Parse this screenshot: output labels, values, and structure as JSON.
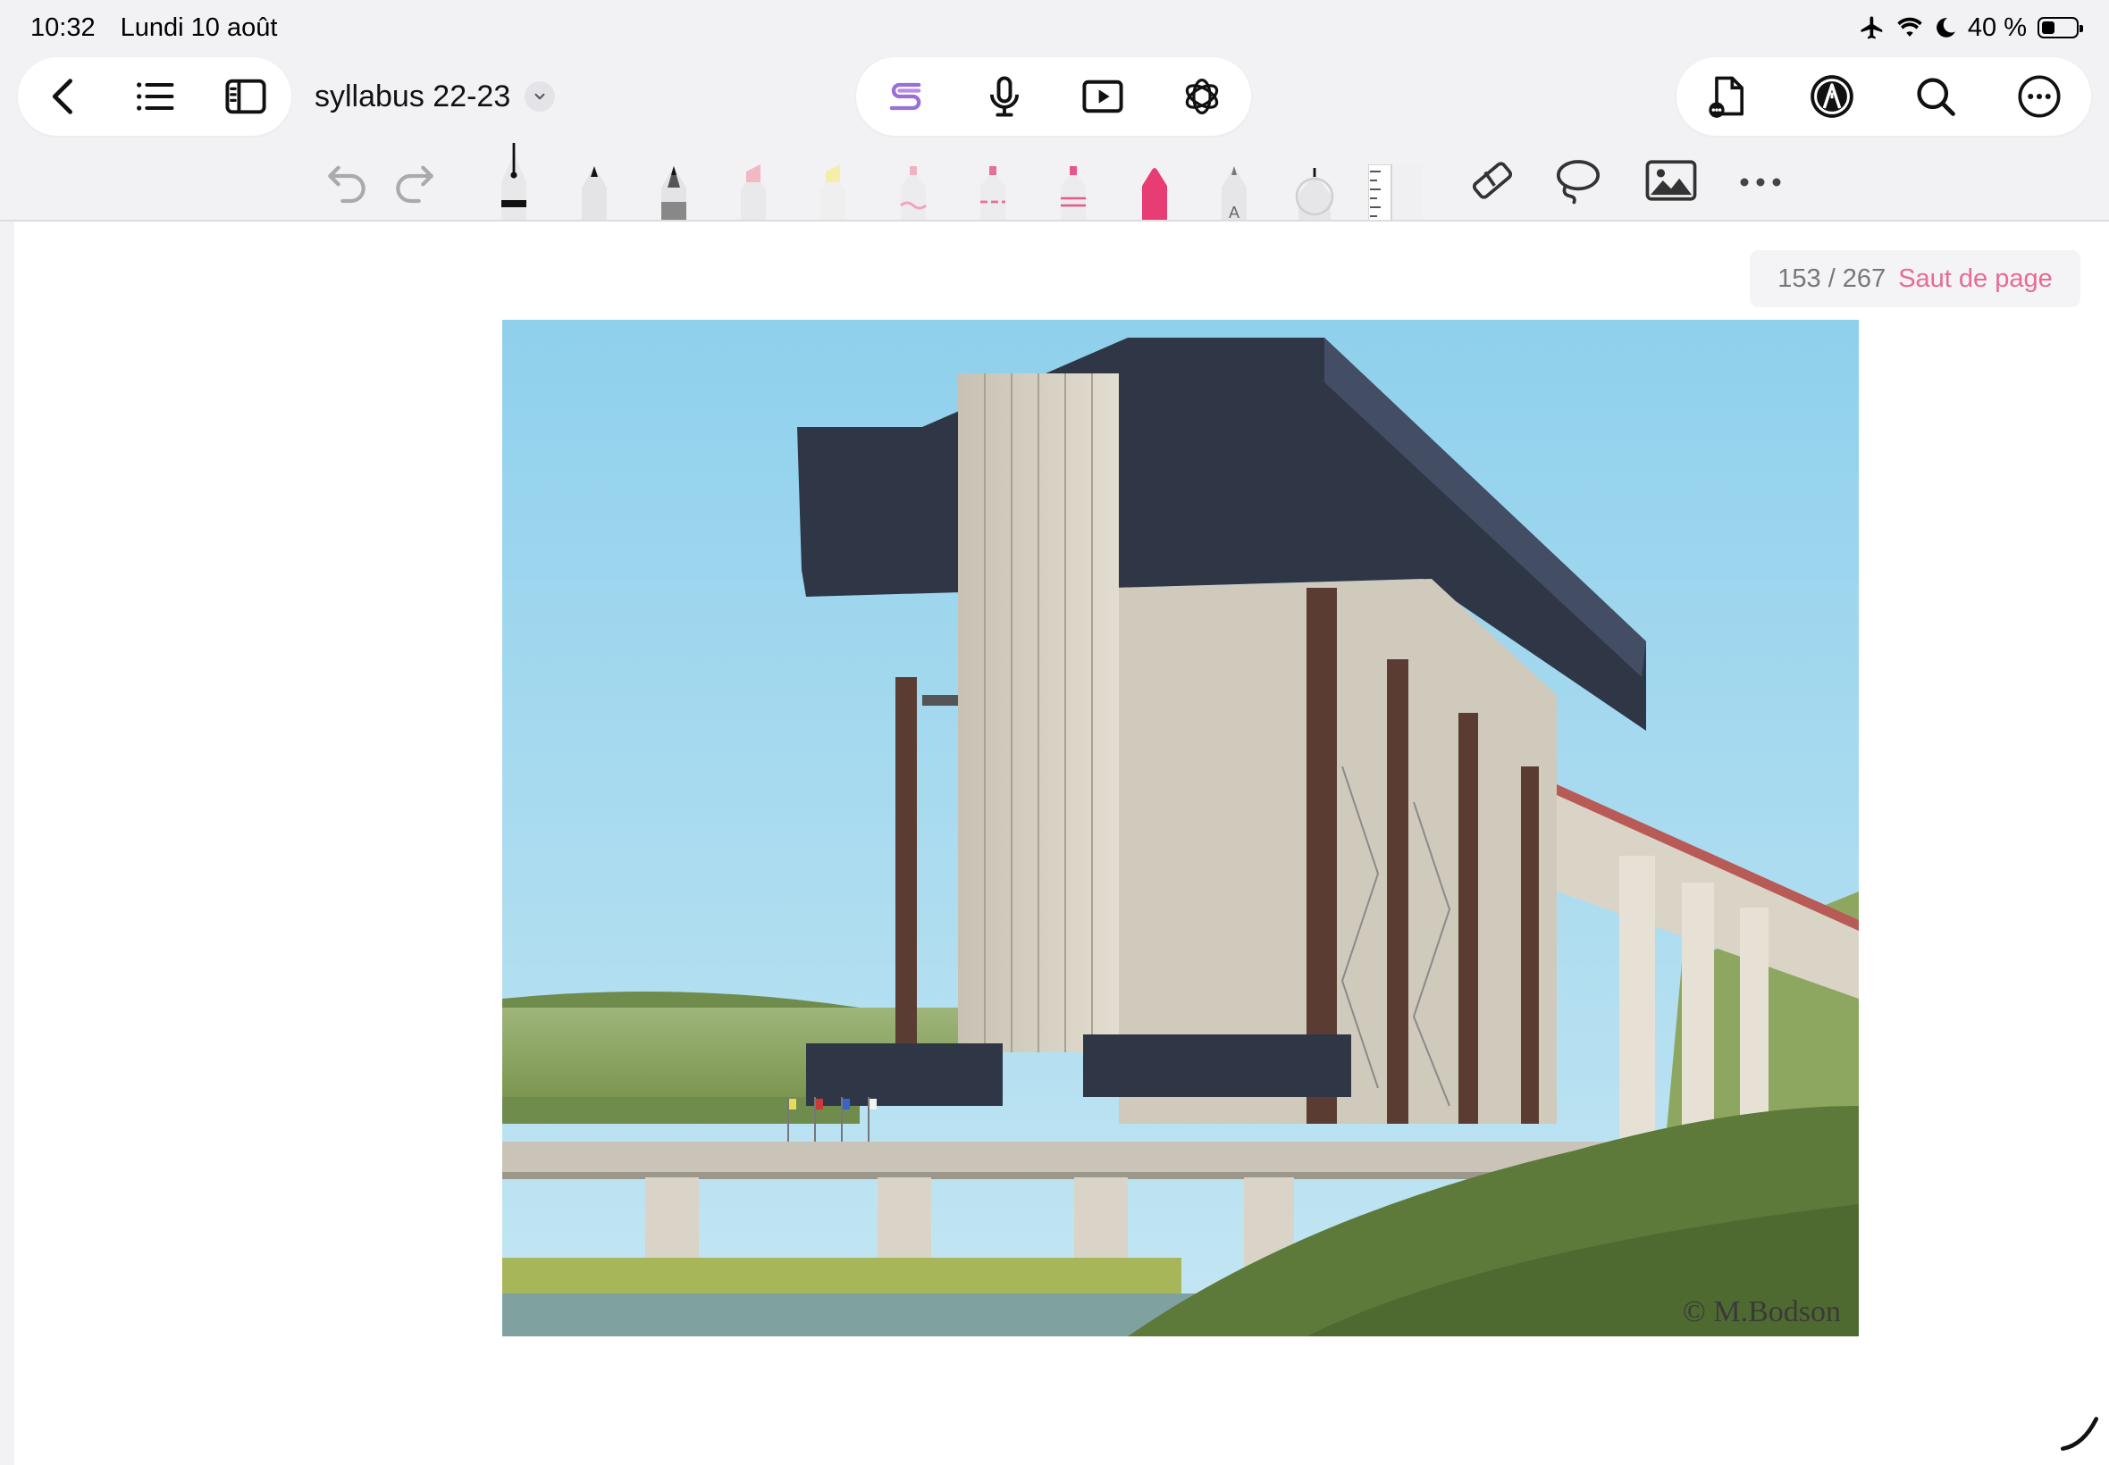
{
  "status_bar": {
    "time": "10:32",
    "date": "Lundi 10 août",
    "battery": "40 %",
    "battery_level": 0.4,
    "icons": [
      "airplane-icon",
      "wifi-icon",
      "moon-icon",
      "battery-icon"
    ]
  },
  "nav": {
    "left_icons": [
      "back-icon",
      "list-icon",
      "sidebar-icon"
    ],
    "center_icons": [
      "goodnotes-ai-icon",
      "microphone-icon",
      "play-icon",
      "chatgpt-icon"
    ],
    "right_icons": [
      "document-options-icon",
      "pen-mode-icon",
      "search-icon",
      "more-icon"
    ]
  },
  "document": {
    "title": "syllabus 22-23"
  },
  "tools": {
    "items": [
      "undo-icon",
      "redo-icon",
      "fountain-pen-icon",
      "pen-icon",
      "pencil-icon",
      "highlighter-pink-icon",
      "highlighter-yellow-icon",
      "marker-wave-icon",
      "marker-dashed-icon",
      "marker-double-icon",
      "marker-magenta-icon",
      "text-pen-icon",
      "laser-icon",
      "ruler-icon",
      "eraser-icon",
      "lasso-icon",
      "image-icon",
      "more-tools-icon"
    ],
    "colors": {
      "accent_pink": "#e96a93",
      "marker_magenta": "#e83c74",
      "highlighter_pink": "#f2b8c6",
      "highlighter_yellow": "#f6eea8"
    }
  },
  "pager": {
    "count": "153 / 267",
    "page_break_label": "Saut de page"
  },
  "photo": {
    "credit": "© M.Bodson"
  }
}
